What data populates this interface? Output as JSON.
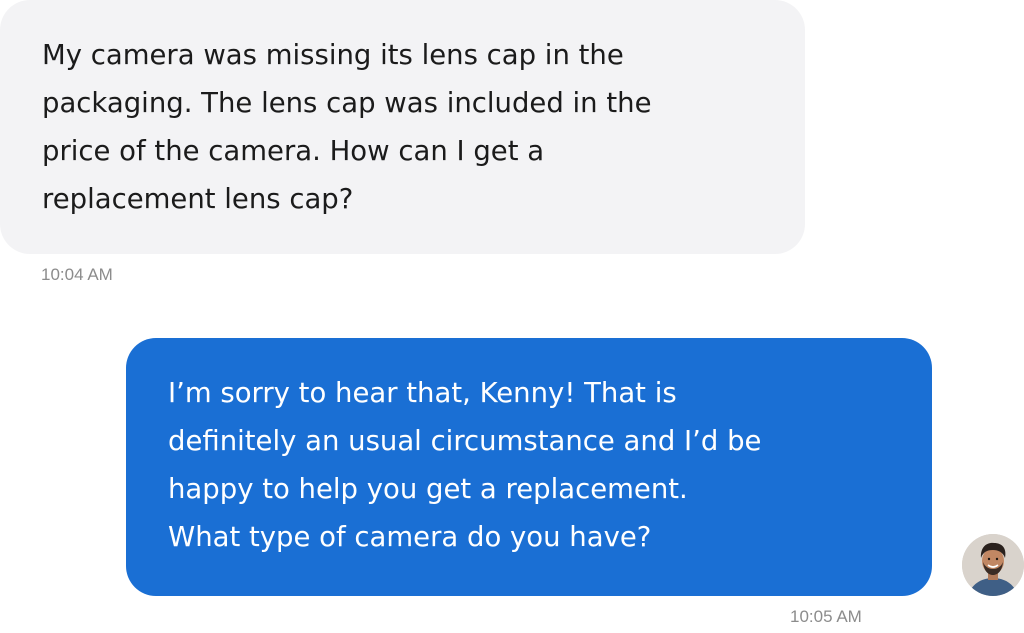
{
  "conversation": {
    "messages": [
      {
        "sender": "customer",
        "lines": [
          "My camera was missing its lens cap in the",
          "packaging. The lens cap was included in the",
          "price of the camera. How can I get a",
          "replacement lens cap?"
        ],
        "time": "10:04 AM"
      },
      {
        "sender": "agent",
        "lines": [
          "I’m sorry to hear that, Kenny! That is",
          "definitely an usual circumstance and I’d be",
          "happy to help you get a replacement.",
          "What type of camera do you have?"
        ],
        "time": "10:05 AM"
      }
    ]
  },
  "colors": {
    "incoming_bubble": "#f3f3f5",
    "outgoing_bubble": "#1a6fd4",
    "timestamp": "#8c8c8c"
  },
  "icons": {
    "agent_avatar": "avatar-photo"
  }
}
